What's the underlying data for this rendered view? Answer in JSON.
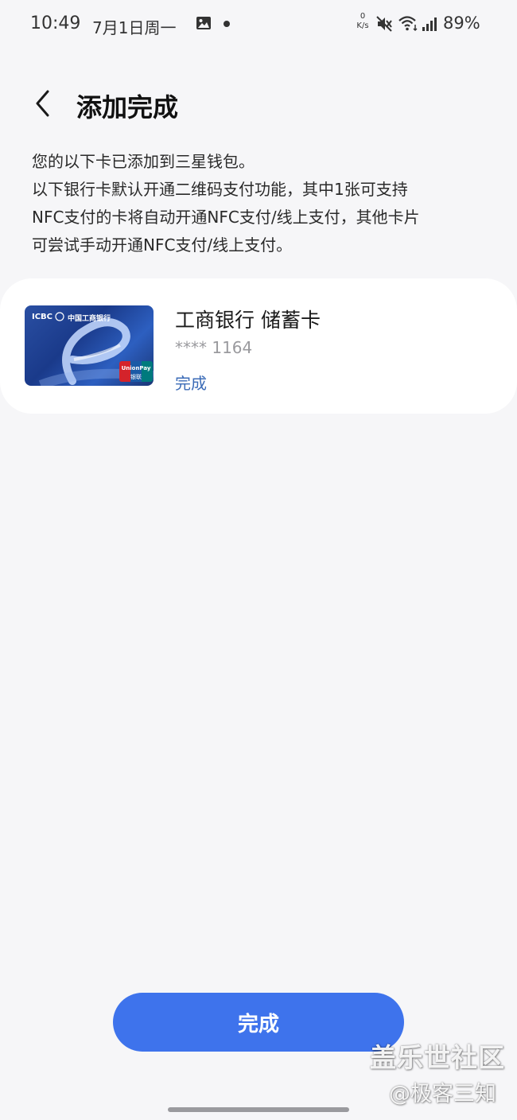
{
  "status_bar": {
    "time": "10:49",
    "date": "7月1日周一",
    "net_speed_value": "0",
    "net_speed_unit": "K/s",
    "battery": "89%"
  },
  "header": {
    "title": "添加完成"
  },
  "description": {
    "lines": [
      "您的以下卡已添加到三星钱包。",
      "以下银行卡默认开通二维码支付功能，其中1张可支持",
      "NFC支付的卡将自动开通NFC支付/线上支付，其他卡片",
      "可尝试手动开通NFC支付/线上支付。"
    ]
  },
  "card": {
    "name": "工商银行  储蓄卡",
    "number": "**** 1164",
    "status": "完成",
    "face_bank_code": "ICBC",
    "face_bank_name": "中国工商银行",
    "face_network": "UnionPay",
    "face_network_cn": "银联"
  },
  "footer": {
    "done_label": "完成"
  },
  "watermark": {
    "line1": "盖乐世社区",
    "line2": "@极客三知"
  },
  "colors": {
    "accent": "#3e73ec",
    "link": "#3b6bb7",
    "background": "#f6f6f8"
  }
}
